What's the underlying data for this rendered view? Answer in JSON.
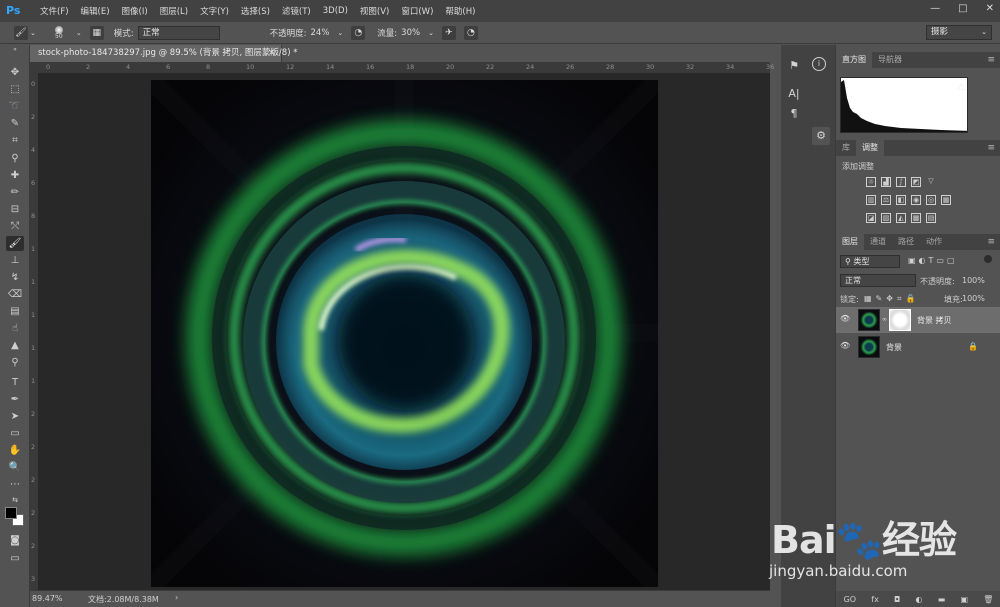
{
  "app": {
    "logo": "Ps"
  },
  "menu": [
    "文件(F)",
    "编辑(E)",
    "图像(I)",
    "图层(L)",
    "文字(Y)",
    "选择(S)",
    "滤镜(T)",
    "3D(D)",
    "视图(V)",
    "窗口(W)",
    "帮助(H)"
  ],
  "window_controls": {
    "minimize": "—",
    "maximize": "□",
    "close": "✕"
  },
  "options": {
    "brush_size": "50",
    "mode_label": "模式:",
    "mode_value": "正常",
    "opacity_label": "不透明度:",
    "opacity_value": "24%",
    "flow_label": "流量:",
    "flow_value": "30%",
    "workspace": "摄影"
  },
  "document": {
    "tab_title": "stock-photo-184738297.jpg @ 89.5% (背景 拷贝, 图层蒙版/8) *",
    "close": "×"
  },
  "ruler_top": [
    "0",
    "2",
    "4",
    "6",
    "8",
    "10",
    "12",
    "14",
    "16",
    "18",
    "20",
    "22",
    "24",
    "26",
    "28",
    "30",
    "32",
    "34",
    "36"
  ],
  "ruler_left": [
    "0",
    "2",
    "4",
    "6",
    "8",
    "1",
    "1",
    "1",
    "1",
    "1",
    "2",
    "2",
    "2",
    "2",
    "2",
    "3"
  ],
  "status": {
    "zoom": "89.47%",
    "doc_info": "文档:2.08M/8.38M",
    "arrow": "›"
  },
  "panels": {
    "histogram_tabs": [
      "直方图",
      "导航器"
    ],
    "adjust_tabs": [
      "库",
      "调整"
    ],
    "adjust_title": "添加调整",
    "layers_tabs": [
      "图层",
      "通道",
      "路径",
      "动作"
    ],
    "filter_kind": "类型",
    "blend_mode": "正常",
    "opacity_label": "不透明度:",
    "opacity_value": "100%",
    "lock_label": "锁定:",
    "fill_label": "填充:",
    "fill_value": "100%",
    "layers": [
      {
        "name": "背景 拷贝",
        "selected": true
      },
      {
        "name": "背景",
        "selected": false,
        "locked": true
      }
    ],
    "bottom_icons": [
      "GO",
      "fx",
      "◘",
      "◐",
      "▬",
      "▣",
      "🗑"
    ]
  },
  "watermark": {
    "logo": "Bai🐾经验",
    "url": "jingyan.baidu.com"
  }
}
